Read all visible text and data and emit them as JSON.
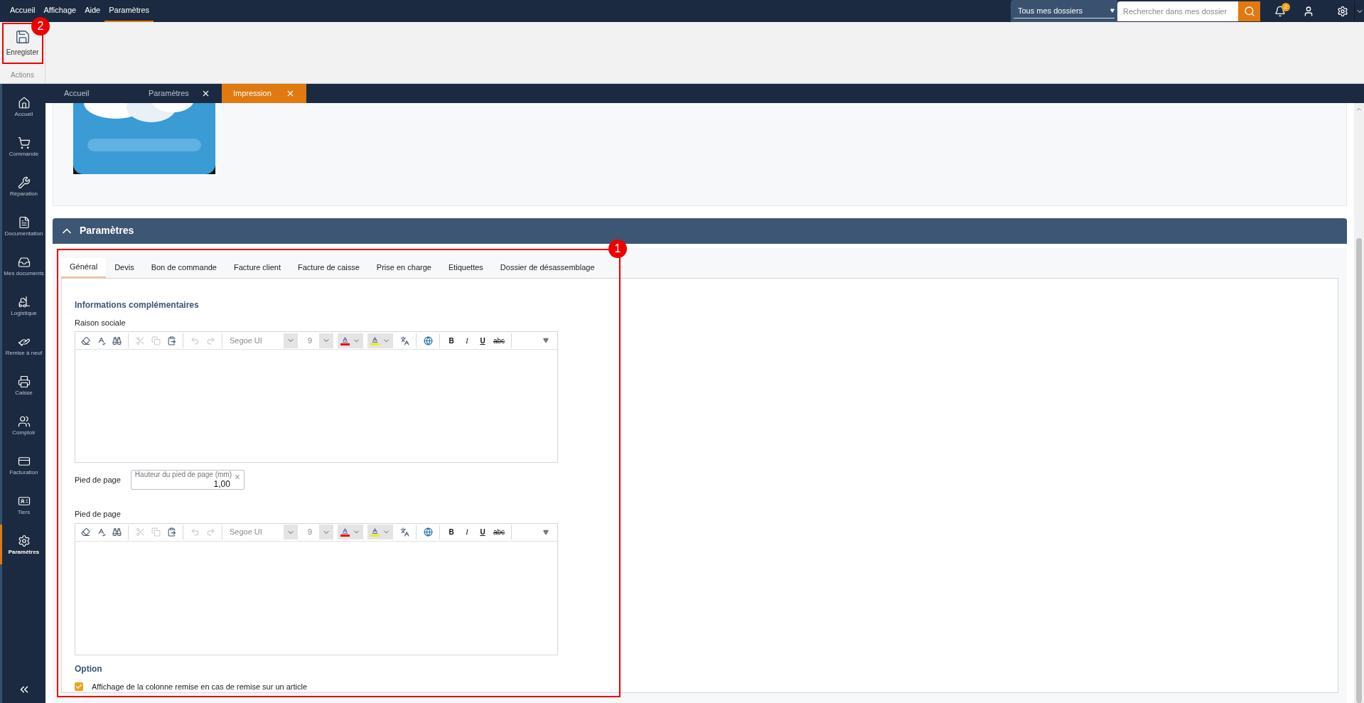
{
  "menu": [
    {
      "label": "Accueil",
      "selected": false
    },
    {
      "label": "Affichage",
      "selected": false
    },
    {
      "label": "Aide",
      "selected": false
    },
    {
      "label": "Paramètres",
      "selected": true
    }
  ],
  "header": {
    "folder_select": "Tous mes dossiers",
    "search": {
      "placeholder": "Rechercher dans mes dossier"
    },
    "notifications": "2"
  },
  "ribbon": {
    "buttons": [
      {
        "label": "Enregister"
      }
    ],
    "group": "Actions"
  },
  "sidebar": {
    "items": [
      {
        "label": "Accueil",
        "selected": false
      },
      {
        "label": "Commande",
        "selected": false
      },
      {
        "label": "Réparation",
        "selected": false
      },
      {
        "label": "Documentation",
        "selected": false
      },
      {
        "label": "Mes documents",
        "selected": false
      },
      {
        "label": "Logistique",
        "selected": false
      },
      {
        "label": "Remise à neuf",
        "selected": false
      },
      {
        "label": "Caisse",
        "selected": false
      },
      {
        "label": "Comptoir",
        "selected": false
      },
      {
        "label": "Facturation",
        "selected": false
      },
      {
        "label": "Tiers",
        "selected": false
      },
      {
        "label": "Paramètres",
        "selected": true
      }
    ]
  },
  "doc_tabs": [
    {
      "label": "Accueil",
      "selected": false,
      "closable": false
    },
    {
      "label": "Paramètres",
      "selected": false,
      "closable": true
    },
    {
      "label": "Impression",
      "selected": true,
      "closable": true
    }
  ],
  "section": {
    "title": "Paramètres",
    "expanded": true
  },
  "settings_tabs": [
    {
      "label": "Général",
      "selected": true
    },
    {
      "label": "Devis",
      "selected": false
    },
    {
      "label": "Bon de commande",
      "selected": false
    },
    {
      "label": "Facture client",
      "selected": false
    },
    {
      "label": "Facture de caisse",
      "selected": false
    },
    {
      "label": "Prise en charge",
      "selected": false
    },
    {
      "label": "Etiquettes",
      "selected": false
    },
    {
      "label": "Dossier de désassemblage",
      "selected": false
    }
  ],
  "form": {
    "heading": "Informations complémentaires",
    "editors": [
      {
        "label": "Raison sociale",
        "font": "Segoe UI",
        "size": "9",
        "toolbar_icons": [
          {
            "disabled": false
          },
          {
            "disabled": false
          },
          {
            "disabled": false
          },
          {
            "disabled": true
          },
          {
            "disabled": true
          },
          {
            "disabled": false
          },
          {
            "disabled": true
          },
          {
            "disabled": true
          }
        ],
        "format_buttons": [
          "B",
          "I",
          "U",
          "abc"
        ]
      },
      {
        "label": "Pied de page",
        "font": "Segoe UI",
        "size": "9",
        "toolbar_icons": [
          {
            "disabled": false
          },
          {
            "disabled": false
          },
          {
            "disabled": false
          },
          {
            "disabled": true
          },
          {
            "disabled": true
          },
          {
            "disabled": false
          },
          {
            "disabled": true
          },
          {
            "disabled": true
          }
        ],
        "format_buttons": [
          "B",
          "I",
          "U",
          "abc"
        ]
      }
    ],
    "footer_height": {
      "row_label": "Pied de page",
      "label": "Hauteur du pied de page (mm)",
      "value": "1,00"
    },
    "option_heading": "Option",
    "options": [
      {
        "label": "Affichage de la colonne remise en cas de remise sur un article",
        "checked": true
      }
    ]
  },
  "annotations": [
    {
      "label": "1"
    },
    {
      "label": "2"
    }
  ]
}
